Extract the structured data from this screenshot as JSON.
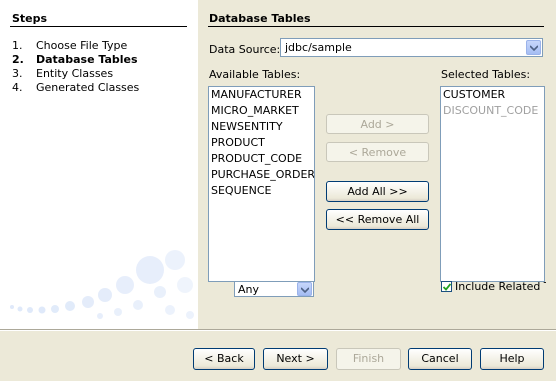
{
  "steps": {
    "title": "Steps",
    "items": [
      {
        "num": "1.",
        "label": "Choose File Type"
      },
      {
        "num": "2.",
        "label": "Database Tables"
      },
      {
        "num": "3.",
        "label": "Entity Classes"
      },
      {
        "num": "4.",
        "label": "Generated Classes"
      }
    ],
    "current_index": 1
  },
  "panel": {
    "title": "Database Tables",
    "data_source": {
      "label": "Data Source:",
      "value": "jdbc/sample"
    },
    "available": {
      "label": "Available Tables:",
      "items": [
        "MANUFACTURER",
        "MICRO_MARKET",
        "NEWSENTITY",
        "PRODUCT",
        "PRODUCT_CODE",
        "PURCHASE_ORDER",
        "SEQUENCE"
      ],
      "filter_value": "Any"
    },
    "selected": {
      "label": "Selected Tables:",
      "items": [
        {
          "label": "CUSTOMER",
          "dim": false
        },
        {
          "label": "DISCOUNT_CODE",
          "dim": true
        }
      ],
      "include_related": {
        "label": "Include Related Tables",
        "checked": true
      }
    },
    "buttons": {
      "add": "Add >",
      "remove": "< Remove",
      "add_all": "Add All >>",
      "remove_all": "<< Remove All"
    }
  },
  "footer": {
    "back": "< Back",
    "next": "Next >",
    "finish": "Finish",
    "cancel": "Cancel",
    "help": "Help"
  },
  "colors": {
    "dialog_bg": "#ece9d8",
    "button_border": "#003c74",
    "field_border": "#7f9db9",
    "bubble_tint": "#c9daf6"
  }
}
